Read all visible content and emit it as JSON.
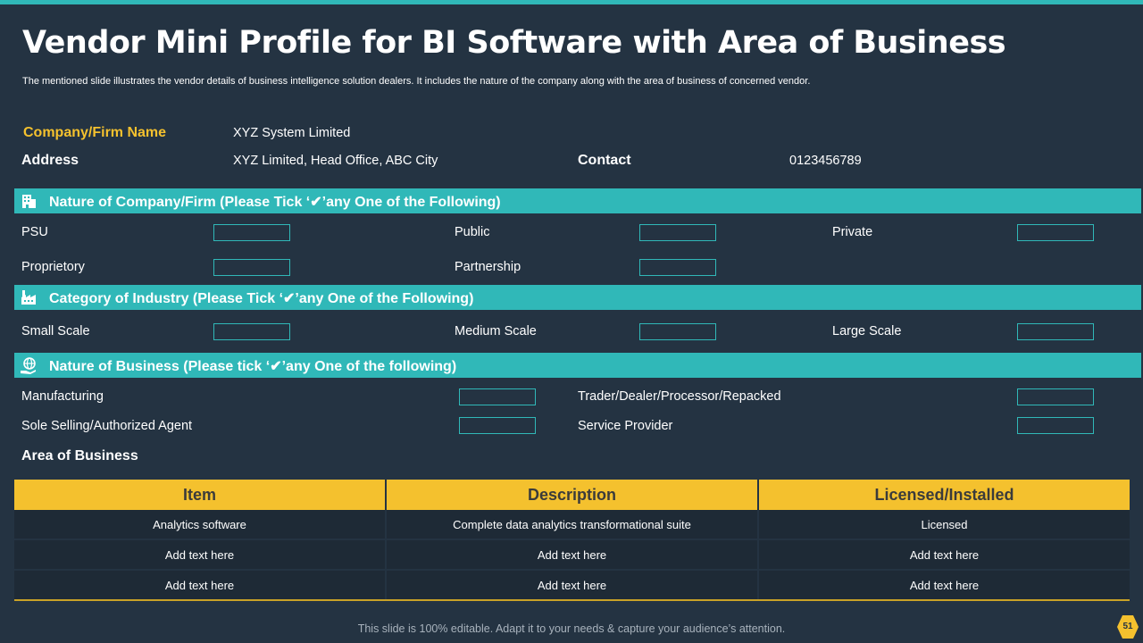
{
  "title": "Vendor Mini Profile for BI Software with Area of Business",
  "subtitle": "The mentioned slide illustrates the vendor details of business intelligence solution dealers. It includes the nature of the company along with the area of business of concerned vendor.",
  "company": {
    "name_label": "Company/Firm Name",
    "name_value": "XYZ System Limited",
    "address_label": "Address",
    "address_value": "XYZ Limited, Head Office, ABC City",
    "contact_label": "Contact",
    "contact_value": "0123456789"
  },
  "nature_of_company": {
    "heading": "Nature of Company/Firm (Please Tick ‘✔’any One of the Following)",
    "icon": "building-icon",
    "options": [
      "PSU",
      "Public",
      "Private",
      "Proprietory",
      "Partnership"
    ]
  },
  "category_of_industry": {
    "heading": "Category of Industry (Please Tick ‘✔’any One of the Following)",
    "icon": "factory-icon",
    "options": [
      "Small Scale",
      "Medium Scale",
      "Large Scale"
    ]
  },
  "nature_of_business": {
    "heading": "Nature of Business (Please tick ‘✔’any One of the following)",
    "icon": "globe-hand-icon",
    "options": [
      "Manufacturing",
      "Trader/Dealer/Processor/Repacked",
      "Sole Selling/Authorized Agent",
      "Service Provider"
    ]
  },
  "area_of_business": {
    "label": "Area of Business",
    "columns": [
      "Item",
      "Description",
      "Licensed/Installed"
    ],
    "rows": [
      [
        "Analytics software",
        "Complete data analytics transformational suite",
        "Licensed"
      ],
      [
        "Add text here",
        "Add text here",
        "Add text here"
      ],
      [
        "Add text here",
        "Add text here",
        "Add text here"
      ]
    ]
  },
  "footer": "This slide is 100% editable. Adapt it to your needs & capture your audience’s attention.",
  "page_number": "51",
  "colors": {
    "background": "#243342",
    "accent_teal": "#30b8b8",
    "accent_yellow": "#f4c12e"
  }
}
